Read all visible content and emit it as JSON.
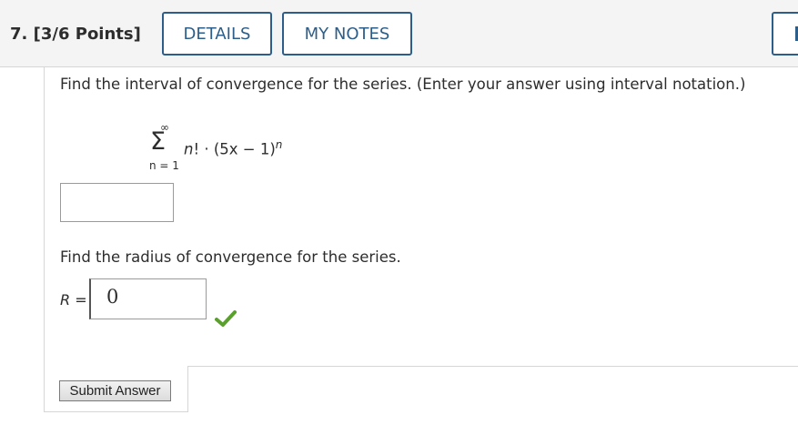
{
  "header": {
    "question_title": "7. [3/6 Points]",
    "details_label": "DETAILS",
    "notes_label": "MY NOTES"
  },
  "question": {
    "prompt_interval": "Find the interval of convergence for the series. (Enter your answer using interval notation.)",
    "series": {
      "upper_limit": "∞",
      "sigma": "Σ",
      "lower_limit": "n = 1",
      "term_prefix": "n",
      "term_middle": "! · (5x − 1)",
      "exponent": "n"
    },
    "interval_answer_value": "",
    "prompt_radius": "Find the radius of convergence for the series.",
    "radius_label_var": "R",
    "radius_label_eq": " = ",
    "radius_answer_value": "0",
    "radius_status": "correct",
    "submit_label": "Submit Answer"
  },
  "colors": {
    "accent": "#2c5e89",
    "check": "#5aa02c"
  }
}
